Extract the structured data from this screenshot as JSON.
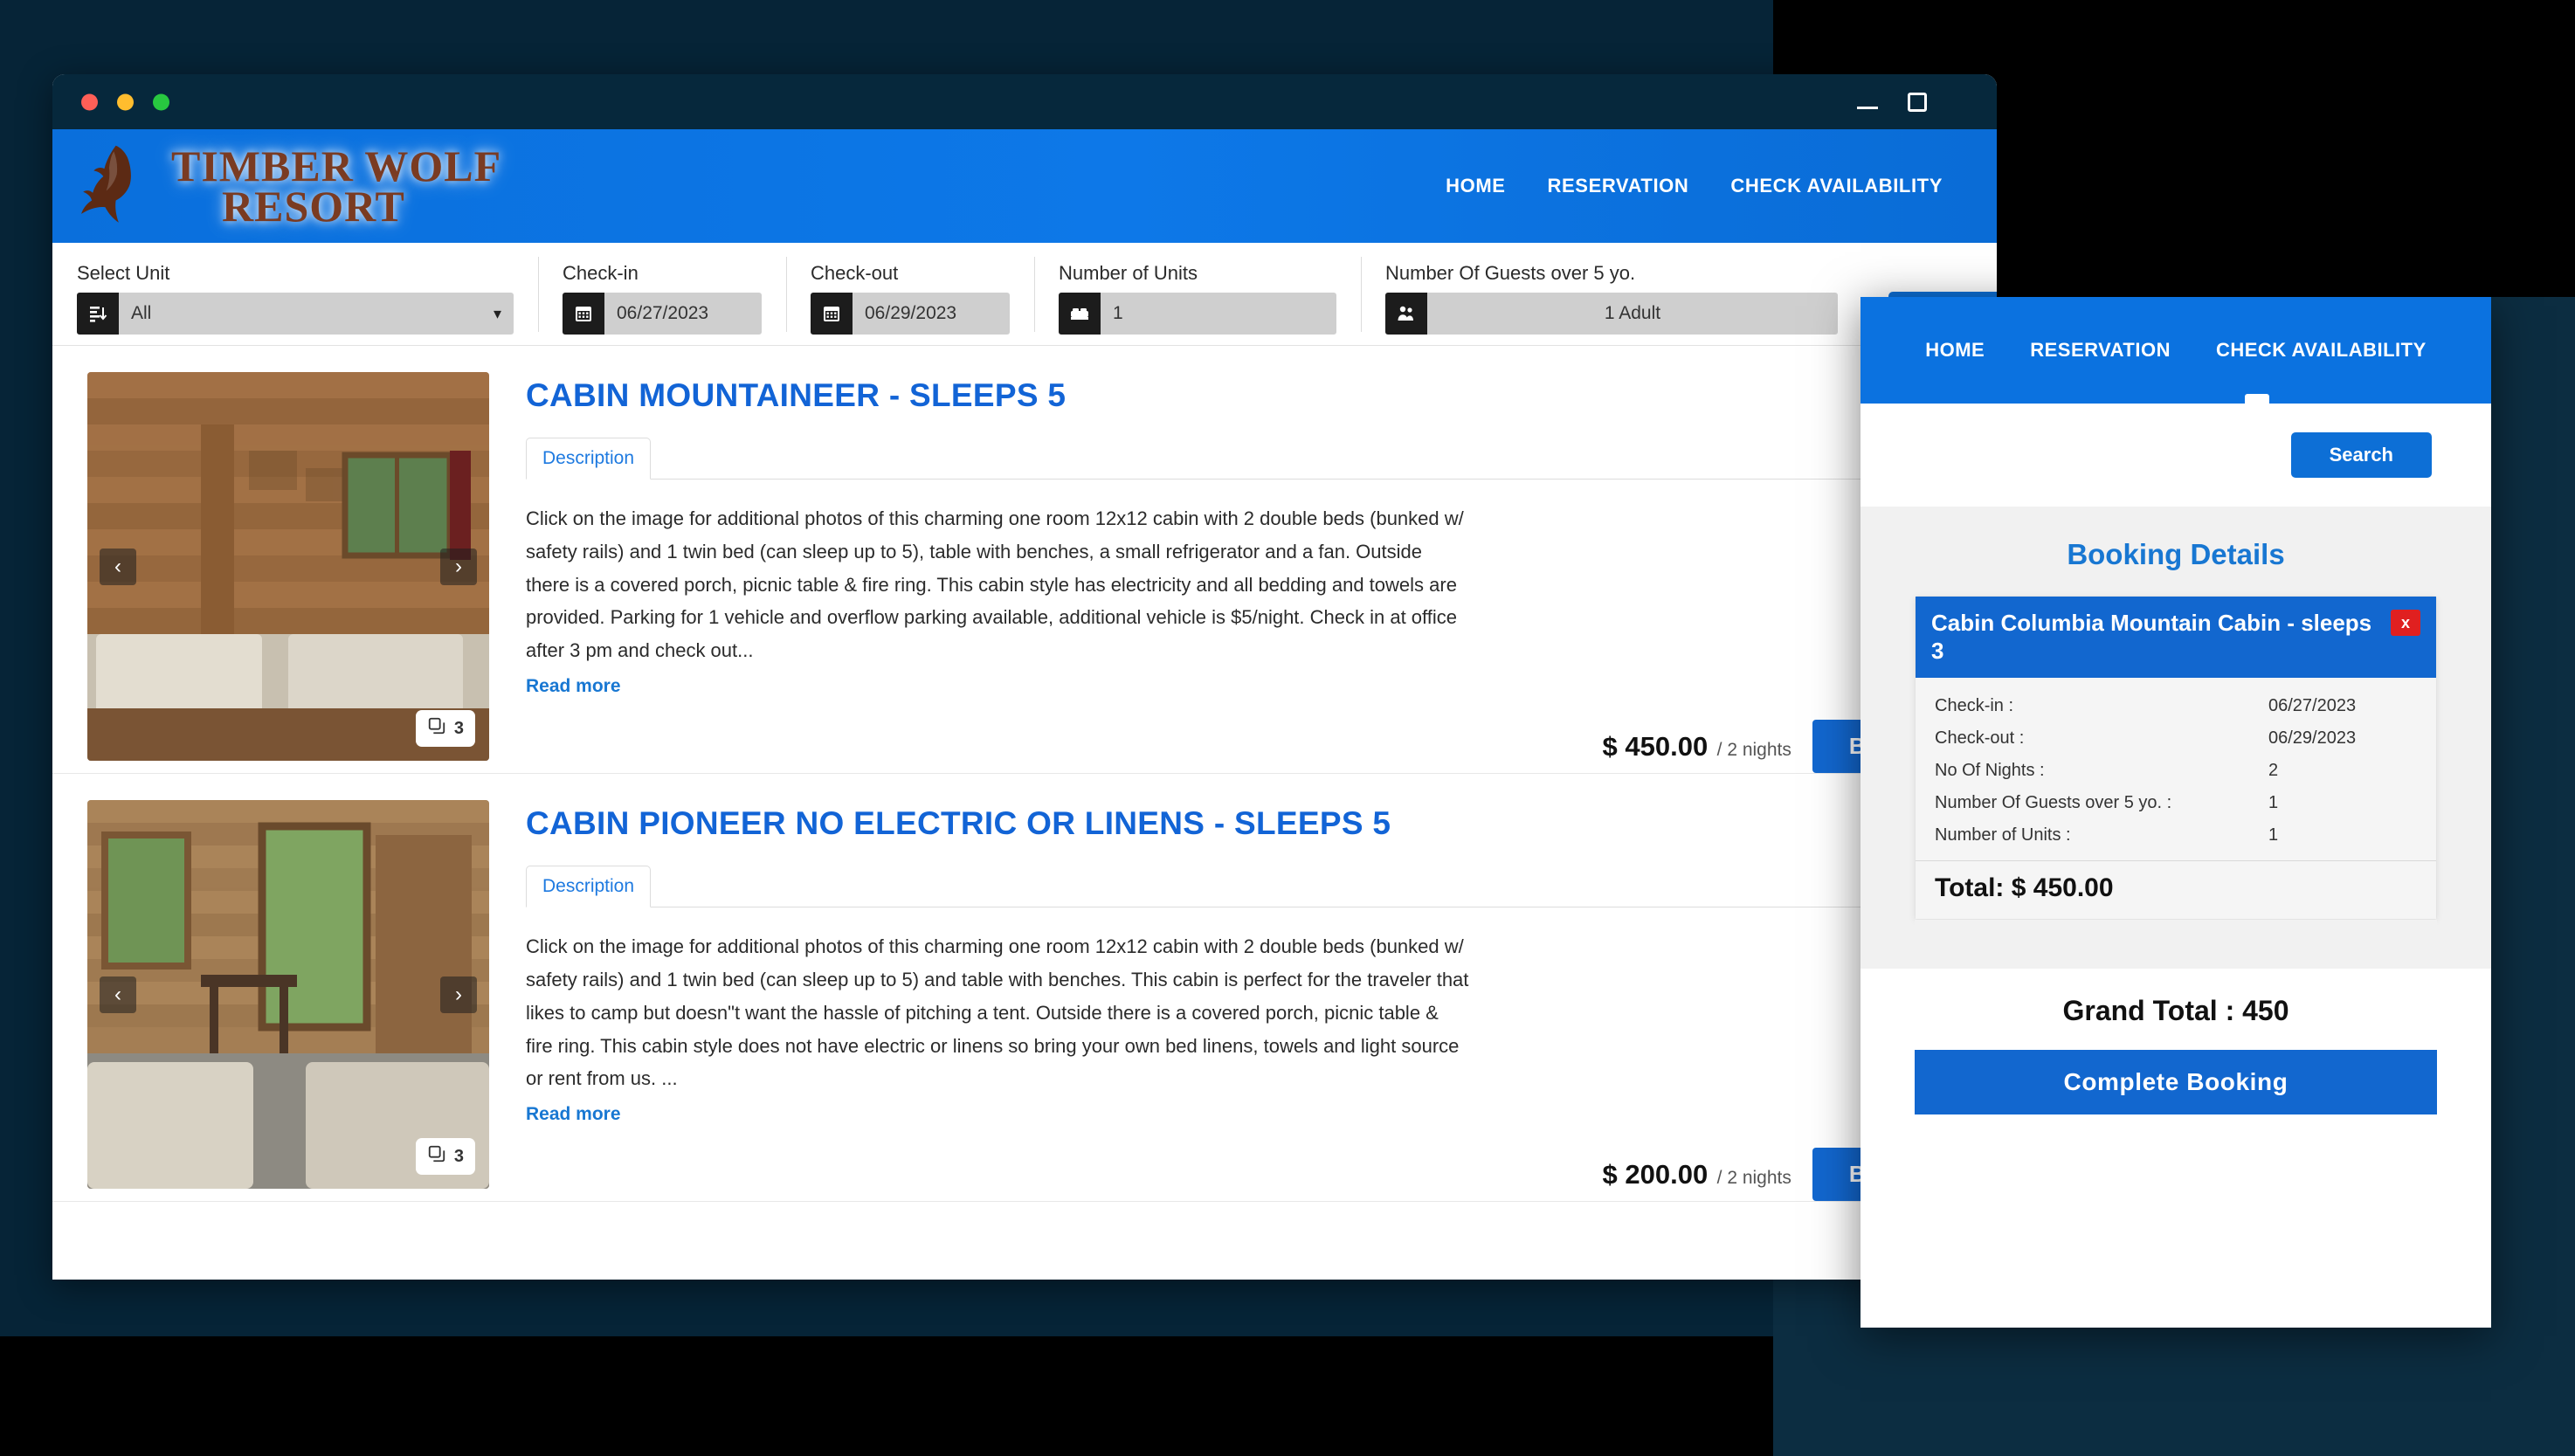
{
  "window": {
    "controls": {
      "minimize": "minimize-icon",
      "maximize": "maximize-icon"
    },
    "dots": [
      "close",
      "minimize",
      "zoom"
    ]
  },
  "header": {
    "logo_line1": "TIMBER WOLF",
    "logo_line2": "RESORT",
    "nav": [
      {
        "label": "HOME"
      },
      {
        "label": "RESERVATION"
      },
      {
        "label": "CHECK AVAILABILITY"
      }
    ]
  },
  "filters": {
    "select_unit": {
      "label": "Select Unit",
      "value": "All",
      "icon": "list-sort-icon"
    },
    "checkin": {
      "label": "Check-in",
      "value": "06/27/2023",
      "icon": "calendar-icon"
    },
    "checkout": {
      "label": "Check-out",
      "value": "06/29/2023",
      "icon": "calendar-icon"
    },
    "units": {
      "label": "Number of Units",
      "value": "1",
      "icon": "bed-icon"
    },
    "guests": {
      "label": "Number Of Guests over 5 yo.",
      "value": "1 Adult",
      "icon": "people-icon"
    },
    "search_label": "Search"
  },
  "listings": [
    {
      "title": "CABIN MOUNTAINEER - SLEEPS 5",
      "tab": "Description",
      "description": "Click on the image for additional photos of this charming one room 12x12 cabin with 2 double beds (bunked w/ safety rails) and 1 twin bed (can sleep up to 5), table with benches, a small refrigerator and a fan. Outside there is a covered porch, picnic table & fire ring. This cabin style has electricity and all bedding and towels are provided. Parking for 1 vehicle and overflow parking available, additional vehicle is $5/night. Check in at office after 3 pm and check out...",
      "read_more": "Read more",
      "price": "$ 450.00",
      "per": "/ 2 nights",
      "book_label": "Book Now",
      "photo_count": "3",
      "prev_icon": "chevron-left-icon",
      "next_icon": "chevron-right-icon"
    },
    {
      "title": "CABIN PIONEER NO ELECTRIC OR LINENS - SLEEPS 5",
      "tab": "Description",
      "description": "Click on the image for additional photos of this charming one room 12x12 cabin with 2 double beds (bunked w/ safety rails) and 1 twin bed (can sleep up to 5) and table with benches. This cabin is perfect for the traveler that likes to camp but doesn\"t want the hassle of pitching a tent. Outside there is a covered porch, picnic table & fire ring. This cabin style does not have electric or linens so bring your own bed linens, towels and light source or rent from us. ...",
      "read_more": "Read more",
      "price": "$ 200.00",
      "per": "/ 2 nights",
      "book_label": "Book Now",
      "photo_count": "3",
      "prev_icon": "chevron-left-icon",
      "next_icon": "chevron-right-icon"
    }
  ],
  "overlay": {
    "nav": [
      {
        "label": "HOME"
      },
      {
        "label": "RESERVATION"
      },
      {
        "label": "CHECK AVAILABILITY"
      }
    ],
    "search_label": "Search",
    "booking_details_title": "Booking Details",
    "card": {
      "title": "Cabin Columbia Mountain Cabin - sleeps 3",
      "close_label": "x",
      "rows": [
        {
          "label": "Check-in :",
          "value": "06/27/2023"
        },
        {
          "label": "Check-out :",
          "value": "06/29/2023"
        },
        {
          "label": "No Of Nights :",
          "value": "2"
        },
        {
          "label": "Number Of Guests over 5 yo. :",
          "value": "1"
        },
        {
          "label": "Number of Units :",
          "value": "1"
        }
      ],
      "total": "Total: $ 450.00"
    },
    "grand_total": "Grand Total : 450",
    "complete_label": "Complete Booking"
  },
  "colors": {
    "brand_blue": "#0b72e0",
    "button_blue": "#1267cf",
    "title_blue": "#1264d6",
    "close_red": "#e02020",
    "titlebar_navy": "#06283c",
    "backdrop": "#0c2d41"
  }
}
